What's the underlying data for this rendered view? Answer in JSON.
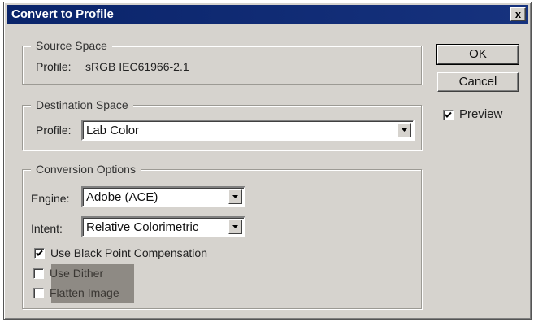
{
  "dialog": {
    "title": "Convert to Profile",
    "close_label": "x"
  },
  "source_space": {
    "legend": "Source Space",
    "profile_label": "Profile:",
    "profile_value": "sRGB IEC61966-2.1"
  },
  "destination_space": {
    "legend": "Destination Space",
    "profile_label": "Profile:",
    "profile_value": "Lab Color"
  },
  "conversion_options": {
    "legend": "Conversion Options",
    "engine_label": "Engine:",
    "engine_value": "Adobe (ACE)",
    "intent_label": "Intent:",
    "intent_value": "Relative Colorimetric",
    "black_point_label": "Use Black Point Compensation",
    "black_point_checked": true,
    "dither_label": "Use Dither",
    "dither_checked": false,
    "flatten_label": "Flatten Image",
    "flatten_checked": false
  },
  "buttons": {
    "ok": "OK",
    "cancel": "Cancel"
  },
  "preview": {
    "label": "Preview",
    "checked": true
  },
  "icons": {
    "close": "close-icon",
    "dropdown": "chevron-down-icon",
    "check": "checkmark-icon"
  }
}
